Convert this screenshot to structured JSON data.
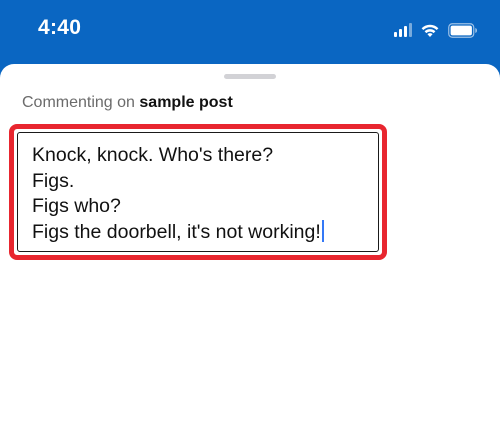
{
  "status_bar": {
    "time": "4:40",
    "icons": [
      "cellular-signal-icon",
      "wifi-icon",
      "battery-icon"
    ],
    "color": "#0a66c2"
  },
  "sheet": {
    "context_prefix": "Commenting on",
    "post_name": "sample post"
  },
  "comment": {
    "lines": [
      "Knock, knock. Who's there?",
      "Figs.",
      "Figs who?",
      "Figs the doorbell, it's not working!"
    ],
    "highlight_color": "#e8262f",
    "caret_color": "#3478f6"
  }
}
